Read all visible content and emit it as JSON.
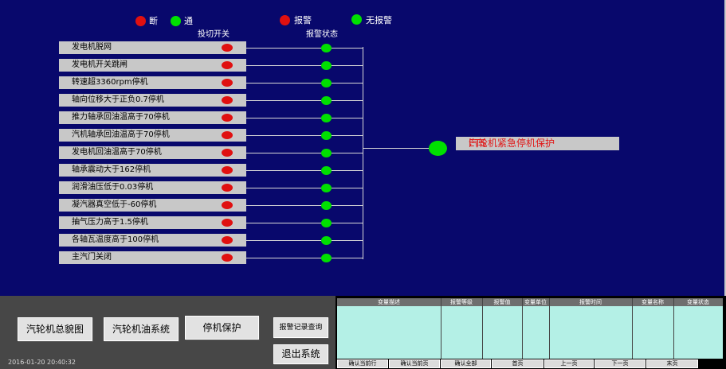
{
  "legend": {
    "off_label": "断",
    "on_label": "通",
    "alarm_label": "报警",
    "no_alarm_label": "无报警"
  },
  "headers": {
    "switch": "投切开关",
    "alarm_status": "报警状态"
  },
  "colors": {
    "background": "#08086c",
    "red": "#e01010",
    "green": "#00e000",
    "panel_grey": "#c8c8c8",
    "alarm_table": "#b4f0e6"
  },
  "rows": [
    {
      "label": "发电机脱网"
    },
    {
      "label": "发电机开关跳闸"
    },
    {
      "label": "转速超3360rpm停机"
    },
    {
      "label": "轴向位移大于正负0.7停机"
    },
    {
      "label": "推力轴承回油温高于70停机"
    },
    {
      "label": "汽机轴承回油温高于70停机"
    },
    {
      "label": "发电机回油温高于70停机"
    },
    {
      "label": "轴承震动大于162停机"
    },
    {
      "label": "润滑油压低于0.03停机"
    },
    {
      "label": "凝汽器真空低于-60停机"
    },
    {
      "label": "抽气压力高于1.5停机"
    },
    {
      "label": "各轴瓦温度高于100停机"
    },
    {
      "label": "主汽门关闭"
    }
  ],
  "ets": {
    "label": "汽轮机紧急停机保护",
    "code": "ETS"
  },
  "nav": {
    "overview": "汽轮机总貌图",
    "oil_system": "汽轮机油系统",
    "trip_protection": "停机保护",
    "alarm_query": "报警记录查询",
    "exit": "退出系统"
  },
  "clock": "2016-01-20  20:40:32",
  "alarm_table": {
    "columns": [
      "变量描述",
      "报警等级",
      "报警值",
      "变量单位",
      "报警时间",
      "变量名称",
      "变量状态"
    ],
    "buttons": [
      "确认当前行",
      "确认当前页",
      "确认全部",
      "首页",
      "上一页",
      "下一页",
      "末页"
    ]
  }
}
